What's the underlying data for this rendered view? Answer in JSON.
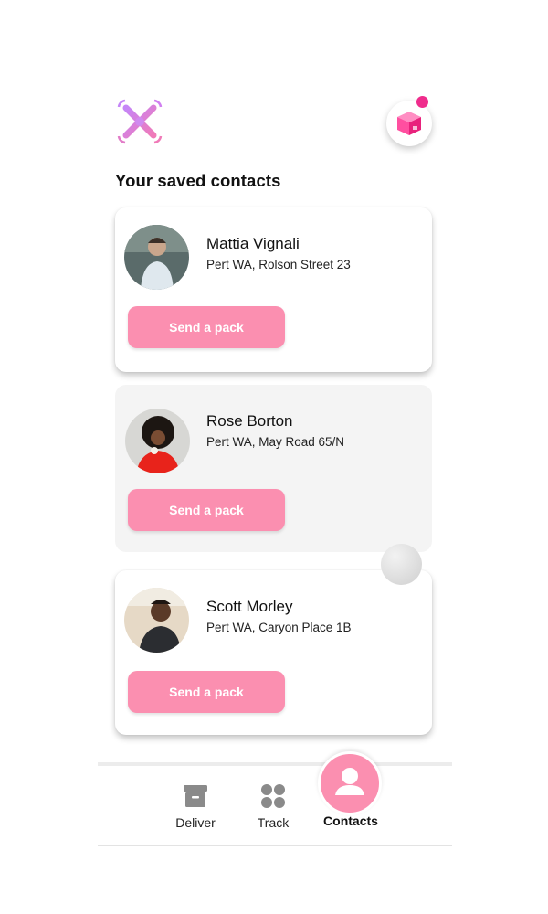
{
  "header": {
    "logo_icon": "drone-logo-icon",
    "parcel_icon": "parcel-box-icon",
    "notification_color": "#ef2c8c"
  },
  "title": "Your saved contacts",
  "accent": "#fb8fb0",
  "contacts": [
    {
      "name": "Mattia Vignali",
      "address": "Pert WA, Rolson Street 23",
      "button_label": "Send a pack"
    },
    {
      "name": "Rose Borton",
      "address": "Pert WA, May Road 65/N",
      "button_label": "Send a pack"
    },
    {
      "name": "Scott Morley",
      "address": "Pert WA, Caryon Place 1B",
      "button_label": "Send a pack"
    }
  ],
  "nav": {
    "deliver": {
      "label": "Deliver",
      "icon": "archive-box-icon"
    },
    "track": {
      "label": "Track",
      "icon": "grid-dots-icon"
    },
    "contacts": {
      "label": "Contacts",
      "icon": "user-icon",
      "active": true
    }
  }
}
